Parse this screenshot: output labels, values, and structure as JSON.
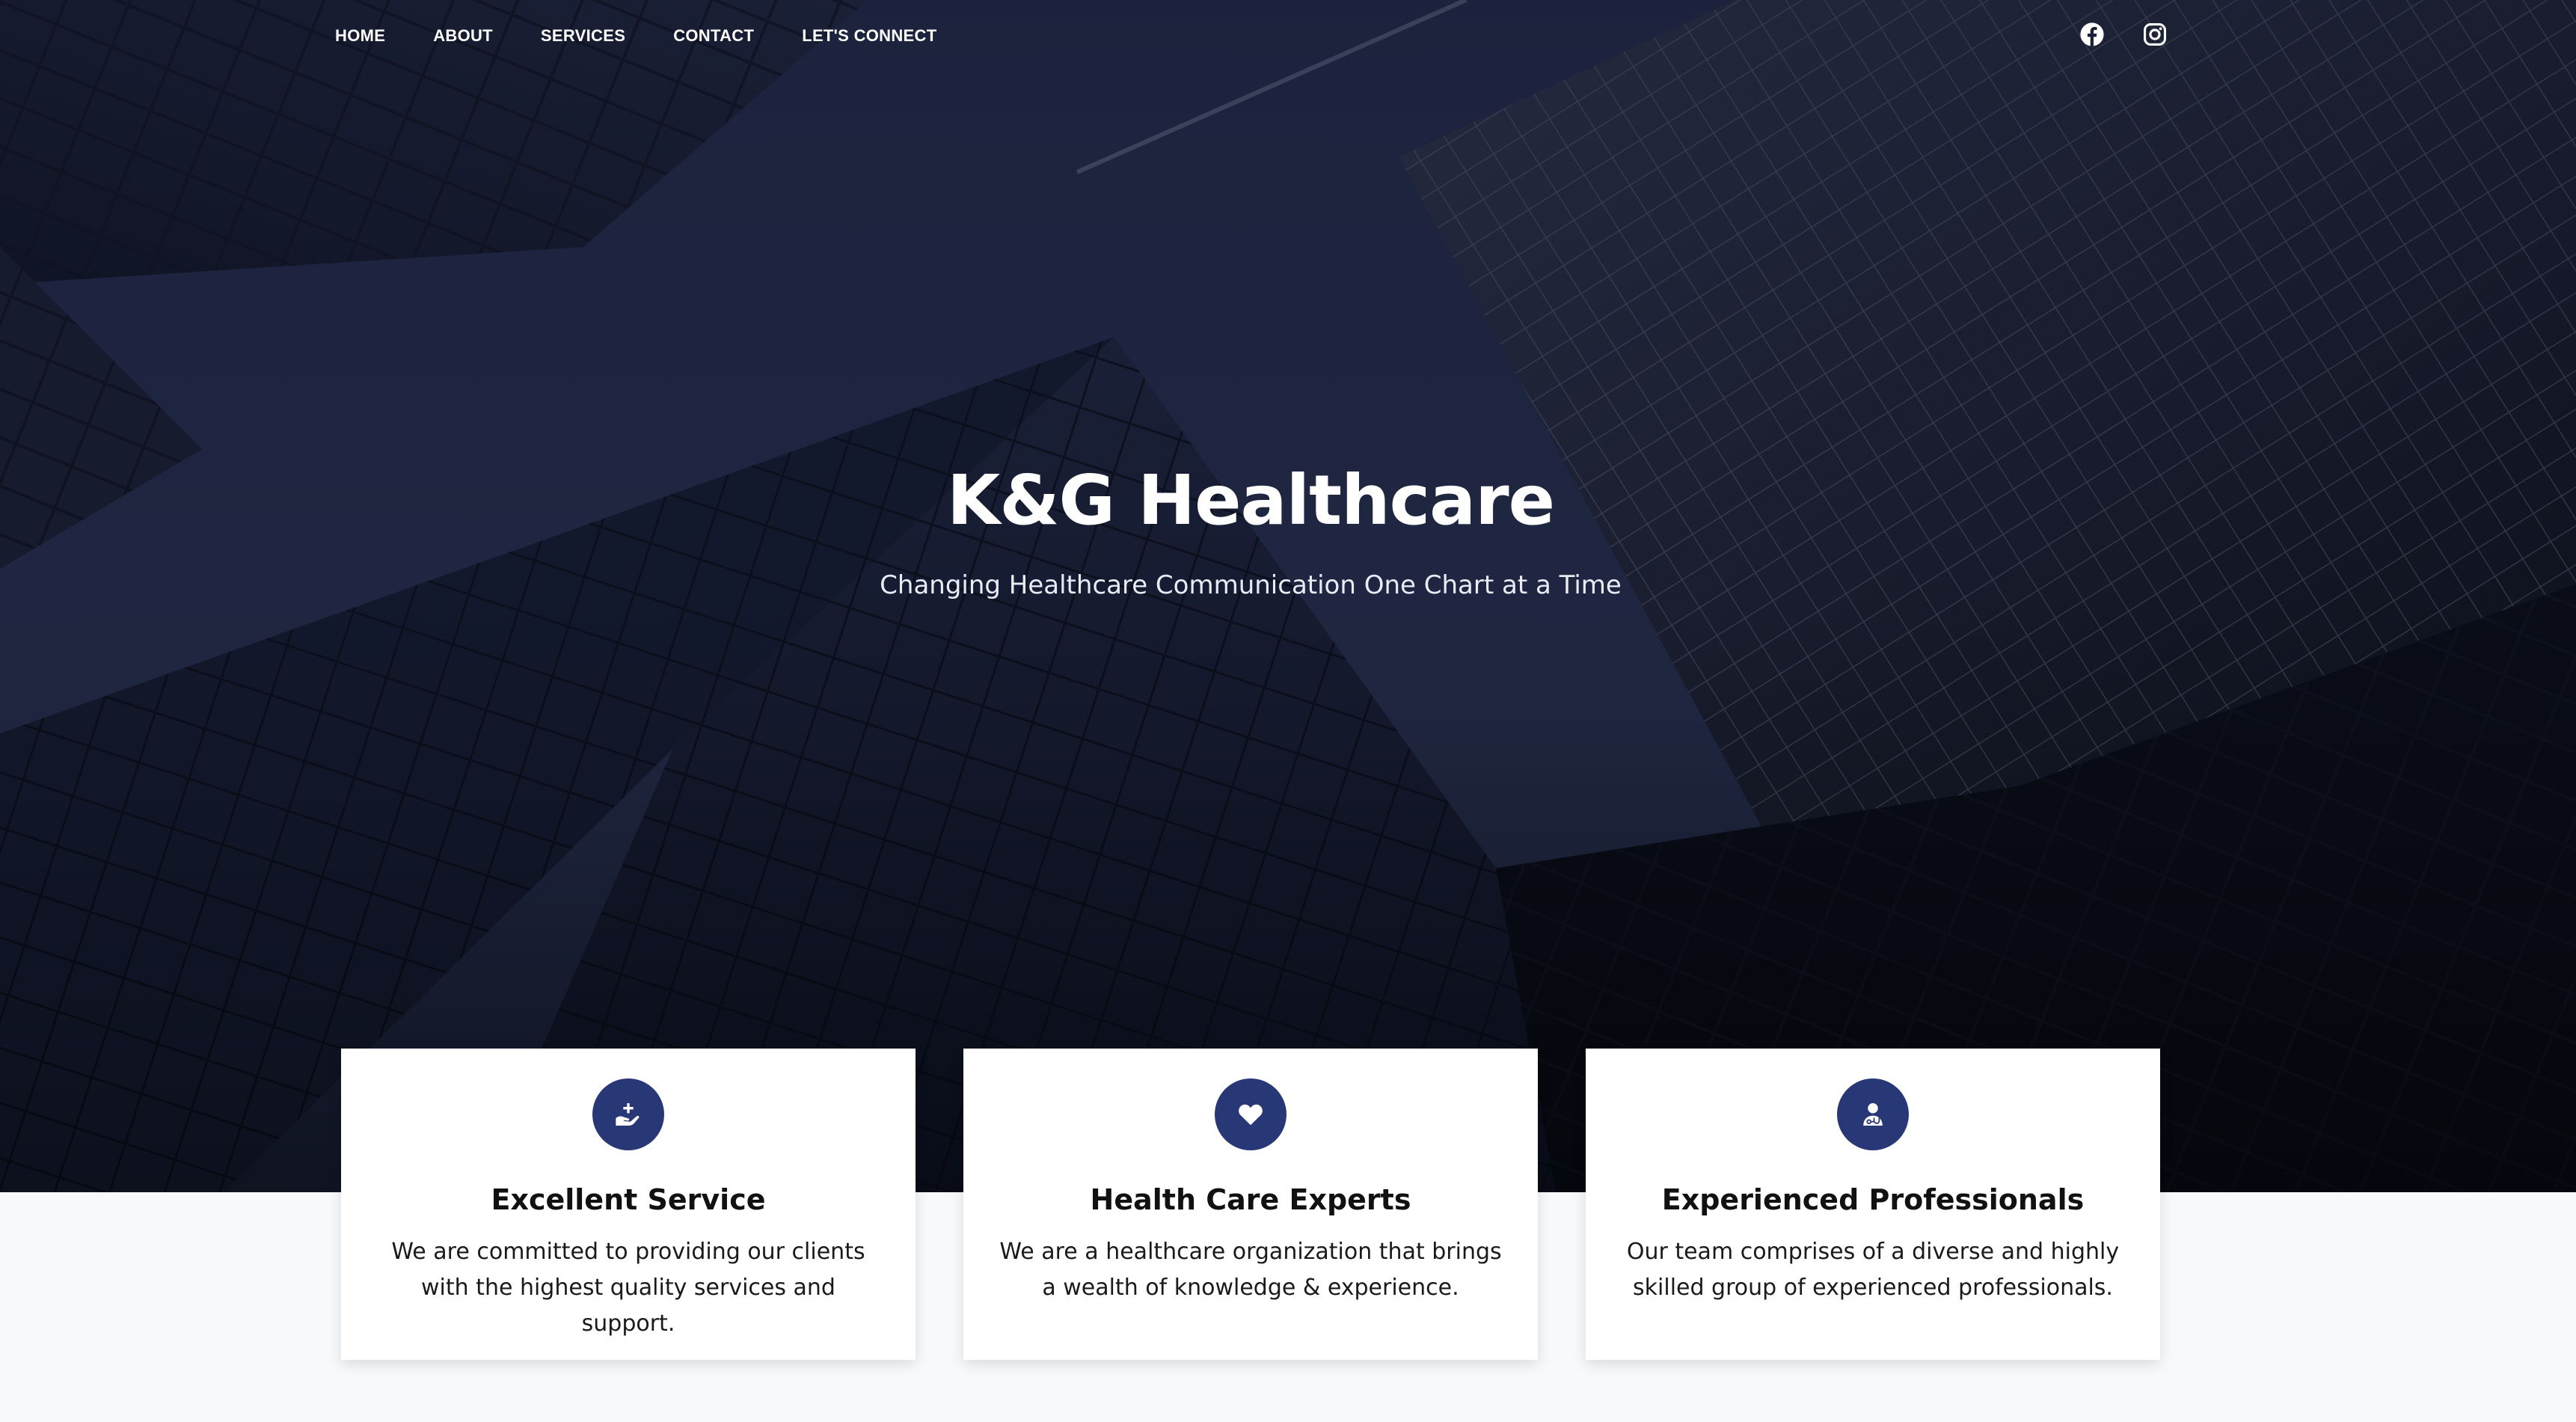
{
  "nav": {
    "items": [
      {
        "label": "HOME"
      },
      {
        "label": "ABOUT"
      },
      {
        "label": "SERVICES"
      },
      {
        "label": "CONTACT"
      },
      {
        "label": "LET'S CONNECT"
      }
    ]
  },
  "social": {
    "icons": [
      "facebook-icon",
      "instagram-icon"
    ]
  },
  "hero": {
    "title": "K&G Healthcare",
    "subtitle": "Changing Healthcare Communication One Chart at a Time"
  },
  "cards": [
    {
      "icon": "hand-plus-icon",
      "title": "Excellent Service",
      "text": "We are committed to providing our clients with the highest quality services and support."
    },
    {
      "icon": "heart-icon",
      "title": "Health Care Experts",
      "text": "We are a healthcare organization that brings a wealth of knowledge & experience."
    },
    {
      "icon": "medical-professional-icon",
      "title": "Experienced Professionals",
      "text": "Our team comprises of a diverse and highly skilled group of experienced professionals."
    }
  ],
  "colors": {
    "accent": "#283776",
    "hero_dark": "#141a2b",
    "page_bg": "#f7f9fb"
  }
}
